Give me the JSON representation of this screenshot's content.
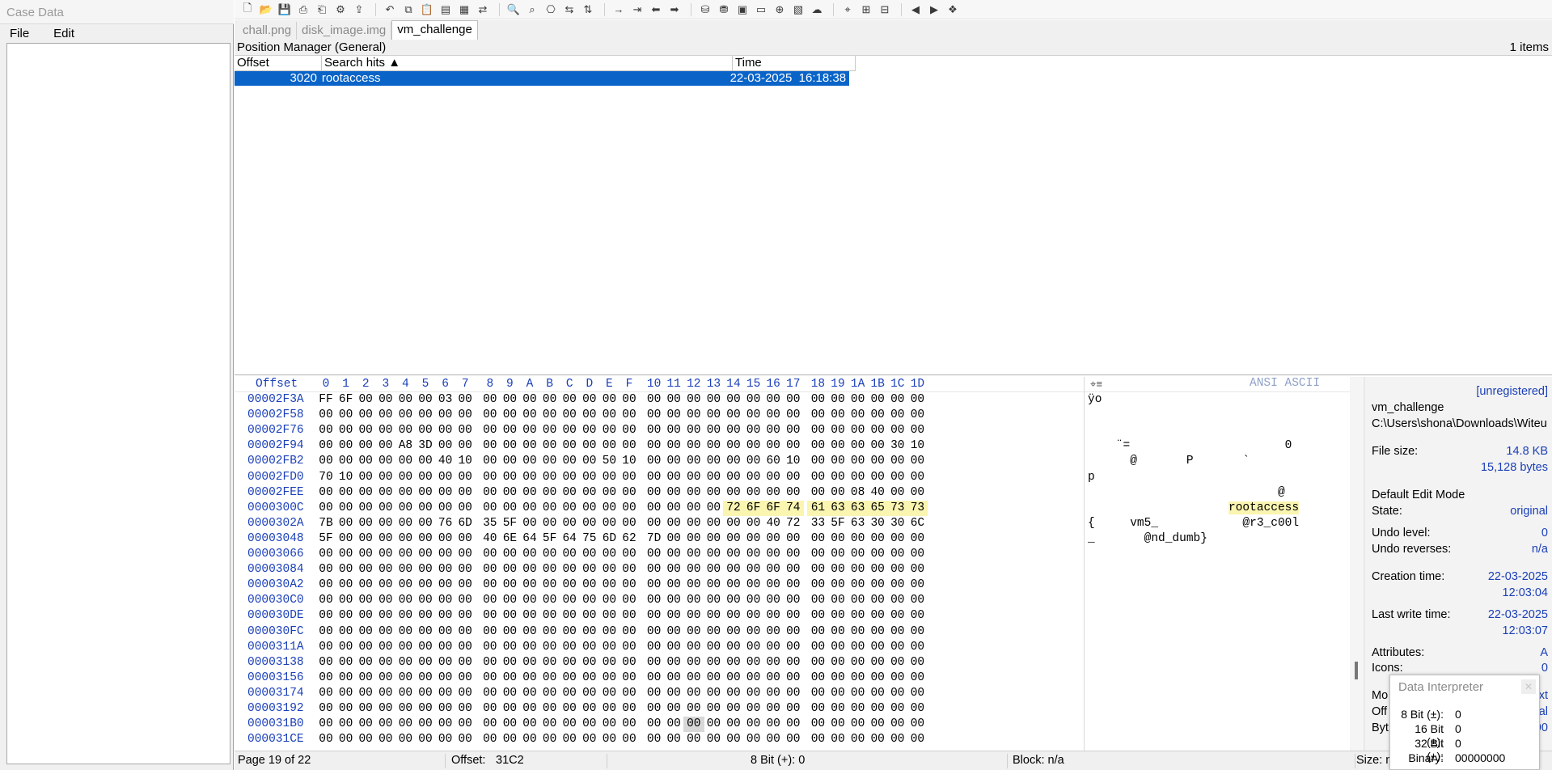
{
  "case": {
    "title": "Case Data",
    "menu": [
      "File",
      "Edit"
    ]
  },
  "toolbar": {
    "icons": [
      "new-file-icon",
      "open-folder-icon",
      "save-icon",
      "print-icon",
      "print-preview-icon",
      "properties-icon",
      "export-icon",
      "undo-icon",
      "copy-icon",
      "paste-icon",
      "paste-block-icon",
      "clipboard-icon",
      "convert-icon",
      "find-icon",
      "find-next-icon",
      "find-hex-icon",
      "replace-icon",
      "replace-hex-icon",
      "goto-offset-icon",
      "goto-sector-icon",
      "back-icon",
      "forward-icon",
      "disk-icon",
      "open-disk-icon",
      "ram-icon",
      "image-icon",
      "zoom-icon",
      "gallery-icon",
      "cloud-icon",
      "search-disk-icon",
      "compare-icon",
      "table-icon",
      "prev-block-icon",
      "next-block-icon",
      "bookmark-icon"
    ]
  },
  "tabs": [
    {
      "label": "chall.png"
    },
    {
      "label": "disk_image.img"
    },
    {
      "label": "vm_challenge",
      "active": true
    }
  ],
  "position_manager": {
    "title": "Position Manager (General)",
    "count": "1 items",
    "columns": [
      "Offset",
      "Search hits ▲",
      "Time"
    ],
    "rows": [
      {
        "offset": "3020",
        "hit": "rootaccess",
        "time": "22-03-2025  16:18:38"
      }
    ]
  },
  "hex": {
    "header_offset": "Offset",
    "columns": [
      "0",
      "1",
      "2",
      "3",
      "4",
      "5",
      "6",
      "7",
      "8",
      "9",
      "A",
      "B",
      "C",
      "D",
      "E",
      "F",
      "10",
      "11",
      "12",
      "13",
      "14",
      "15",
      "16",
      "17",
      "18",
      "19",
      "1A",
      "1B",
      "1C",
      "1D"
    ],
    "ascii_label": "ANSI ASCII",
    "rows": [
      {
        "off": "00002F3A",
        "b": "FF 6F 00 00 00 00 03 00 00 00 00 00 00 00 00 00 00 00 00 00 00 00 00 00 00 00 00 00 00 00",
        "a": "ÿo"
      },
      {
        "off": "00002F58",
        "b": "00 00 00 00 00 00 00 00 00 00 00 00 00 00 00 00 00 00 00 00 00 00 00 00 00 00 00 00 00 00",
        "a": ""
      },
      {
        "off": "00002F76",
        "b": "00 00 00 00 00 00 00 00 00 00 00 00 00 00 00 00 00 00 00 00 00 00 00 00 00 00 00 00 00 00",
        "a": ""
      },
      {
        "off": "00002F94",
        "b": "00 00 00 00 A8 3D 00 00 00 00 00 00 00 00 00 00 00 00 00 00 00 00 00 00 00 00 00 00 30 10",
        "a": "    ¨=                      0"
      },
      {
        "off": "00002FB2",
        "b": "00 00 00 00 00 00 40 10 00 00 00 00 00 00 50 10 00 00 00 00 00 00 60 10 00 00 00 00 00 00",
        "a": "      @       P       `"
      },
      {
        "off": "00002FD0",
        "b": "70 10 00 00 00 00 00 00 00 00 00 00 00 00 00 00 00 00 00 00 00 00 00 00 00 00 00 00 00 00",
        "a": "p"
      },
      {
        "off": "00002FEE",
        "b": "00 00 00 00 00 00 00 00 00 00 00 00 00 00 00 00 00 00 00 00 00 00 00 00 00 00 08 40 00 00",
        "a": "                           @"
      },
      {
        "off": "0000300C",
        "b": "00 00 00 00 00 00 00 00 00 00 00 00 00 00 00 00 00 00 00 00 72 6F 6F 74 61 63 63 65 73 73",
        "a": "                    rootaccess",
        "hl_from": 20
      },
      {
        "off": "0000302A",
        "b": "7B 00 00 00 00 00 76 6D 35 5F 00 00 00 00 00 00 00 00 00 00 00 00 40 72 33 5F 63 30 30 6C",
        "a": "{     vm5_            @r3_c00l"
      },
      {
        "off": "00003048",
        "b": "5F 00 00 00 00 00 00 00 40 6E 64 5F 64 75 6D 62 7D 00 00 00 00 00 00 00 00 00 00 00 00 00",
        "a": "_       @nd_dumb}"
      },
      {
        "off": "00003066",
        "b": "00 00 00 00 00 00 00 00 00 00 00 00 00 00 00 00 00 00 00 00 00 00 00 00 00 00 00 00 00 00",
        "a": ""
      },
      {
        "off": "00003084",
        "b": "00 00 00 00 00 00 00 00 00 00 00 00 00 00 00 00 00 00 00 00 00 00 00 00 00 00 00 00 00 00",
        "a": ""
      },
      {
        "off": "000030A2",
        "b": "00 00 00 00 00 00 00 00 00 00 00 00 00 00 00 00 00 00 00 00 00 00 00 00 00 00 00 00 00 00",
        "a": ""
      },
      {
        "off": "000030C0",
        "b": "00 00 00 00 00 00 00 00 00 00 00 00 00 00 00 00 00 00 00 00 00 00 00 00 00 00 00 00 00 00",
        "a": ""
      },
      {
        "off": "000030DE",
        "b": "00 00 00 00 00 00 00 00 00 00 00 00 00 00 00 00 00 00 00 00 00 00 00 00 00 00 00 00 00 00",
        "a": ""
      },
      {
        "off": "000030FC",
        "b": "00 00 00 00 00 00 00 00 00 00 00 00 00 00 00 00 00 00 00 00 00 00 00 00 00 00 00 00 00 00",
        "a": ""
      },
      {
        "off": "0000311A",
        "b": "00 00 00 00 00 00 00 00 00 00 00 00 00 00 00 00 00 00 00 00 00 00 00 00 00 00 00 00 00 00",
        "a": ""
      },
      {
        "off": "00003138",
        "b": "00 00 00 00 00 00 00 00 00 00 00 00 00 00 00 00 00 00 00 00 00 00 00 00 00 00 00 00 00 00",
        "a": ""
      },
      {
        "off": "00003156",
        "b": "00 00 00 00 00 00 00 00 00 00 00 00 00 00 00 00 00 00 00 00 00 00 00 00 00 00 00 00 00 00",
        "a": ""
      },
      {
        "off": "00003174",
        "b": "00 00 00 00 00 00 00 00 00 00 00 00 00 00 00 00 00 00 00 00 00 00 00 00 00 00 00 00 00 00",
        "a": ""
      },
      {
        "off": "00003192",
        "b": "00 00 00 00 00 00 00 00 00 00 00 00 00 00 00 00 00 00 00 00 00 00 00 00 00 00 00 00 00 00",
        "a": ""
      },
      {
        "off": "000031B0",
        "b": "00 00 00 00 00 00 00 00 00 00 00 00 00 00 00 00 00 00 00 00 00 00 00 00 00 00 00 00 00 00",
        "a": "",
        "cursor": 18
      },
      {
        "off": "000031CE",
        "b": "00 00 00 00 00 00 00 00 00 00 00 00 00 00 00 00 00 00 00 00 00 00 00 00 00 00 00 00 00 00",
        "a": ""
      }
    ]
  },
  "info": {
    "registration": "[unregistered]",
    "filename": "vm_challenge",
    "path": "C:\\Users\\shona\\Downloads\\Witeu",
    "file_size_label": "File size:",
    "file_size_kb": "14.8 KB",
    "file_size_bytes": "15,128 bytes",
    "edit_mode_label": "Default Edit Mode",
    "state_label": "State:",
    "state_value": "original",
    "undo_level_label": "Undo level:",
    "undo_level_value": "0",
    "undo_reverses_label": "Undo reverses:",
    "undo_reverses_value": "n/a",
    "creation_label": "Creation time:",
    "creation_date": "22-03-2025",
    "creation_time": "12:03:04",
    "lastwrite_label": "Last write time:",
    "lastwrite_date": "22-03-2025",
    "lastwrite_time": "12:03:07",
    "attributes_label": "Attributes:",
    "attributes_value": "A",
    "icons_label": "Icons:",
    "icons_value": "0",
    "mode_label": "Mo",
    "mode_value": "ext",
    "offset_label": "Off",
    "offset_value": "nal",
    "bytes_label": "Byt",
    "bytes_value": "90",
    "size_label": "Size: n"
  },
  "data_interpreter": {
    "title": "Data Interpreter",
    "rows": [
      {
        "label": "8 Bit (±):",
        "value": "0"
      },
      {
        "label": "16 Bit (±):",
        "value": "0"
      },
      {
        "label": "32 Bit (±):",
        "value": "0"
      },
      {
        "label": "Binary:",
        "value": "00000000"
      }
    ]
  },
  "status": {
    "page": "Page 19 of 22",
    "offset": "Offset:",
    "offset_value": "31C2",
    "bit": "8 Bit (+): 0",
    "block": "Block: n/a"
  }
}
